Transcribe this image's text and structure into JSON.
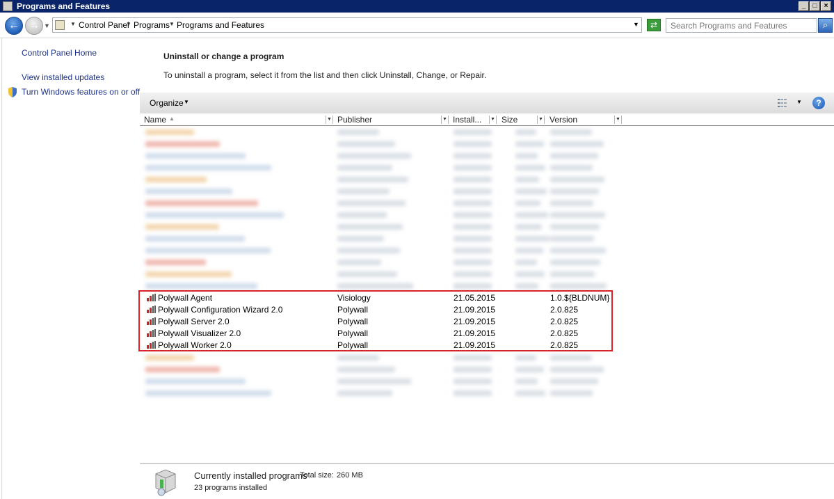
{
  "window": {
    "title": "Programs and Features",
    "controls": {
      "minimize": "_",
      "maximize": "□",
      "close": "×"
    }
  },
  "address_bar": {
    "breadcrumbs": [
      "Control Panel",
      "Programs",
      "Programs and Features"
    ],
    "search_placeholder": "Search Programs and Features"
  },
  "sidebar": {
    "home_link": "Control Panel Home",
    "updates_link": "View installed updates",
    "features_link": "Turn Windows features on or off"
  },
  "main": {
    "heading": "Uninstall or change a program",
    "instructions": "To uninstall a program, select it from the list and then click Uninstall, Change, or Repair.",
    "toolbar": {
      "organize_label": "Organize"
    },
    "columns": {
      "name": "Name",
      "publisher": "Publisher",
      "installed": "Install...",
      "size": "Size",
      "version": "Version"
    },
    "programs": [
      {
        "name": "Polywall Agent",
        "publisher": "Visiology",
        "installed": "21.05.2015",
        "size": "",
        "version": "1.0.${BLDNUM}"
      },
      {
        "name": "Polywall Configuration Wizard 2.0",
        "publisher": "Polywall",
        "installed": "21.09.2015",
        "size": "",
        "version": "2.0.825"
      },
      {
        "name": "Polywall Server 2.0",
        "publisher": "Polywall",
        "installed": "21.09.2015",
        "size": "",
        "version": "2.0.825"
      },
      {
        "name": "Polywall Visualizer 2.0",
        "publisher": "Polywall",
        "installed": "21.09.2015",
        "size": "",
        "version": "2.0.825"
      },
      {
        "name": "Polywall Worker 2.0",
        "publisher": "Polywall",
        "installed": "21.09.2015",
        "size": "",
        "version": "2.0.825"
      }
    ]
  },
  "footer": {
    "title": "Currently installed programs",
    "total_size_label": "Total size:",
    "total_size_value": "260 MB",
    "count_text": "23 programs installed"
  },
  "colors": {
    "highlight_border": "#d9232a",
    "link": "#1e3287",
    "title_bar": "#0a246a"
  },
  "icons": [
    "window-icon",
    "back-arrow-icon",
    "forward-arrow-icon",
    "folder-icon",
    "refresh-icon",
    "search-icon",
    "shield-icon",
    "view-options-icon",
    "help-icon",
    "program-icon",
    "installer-box-icon"
  ]
}
